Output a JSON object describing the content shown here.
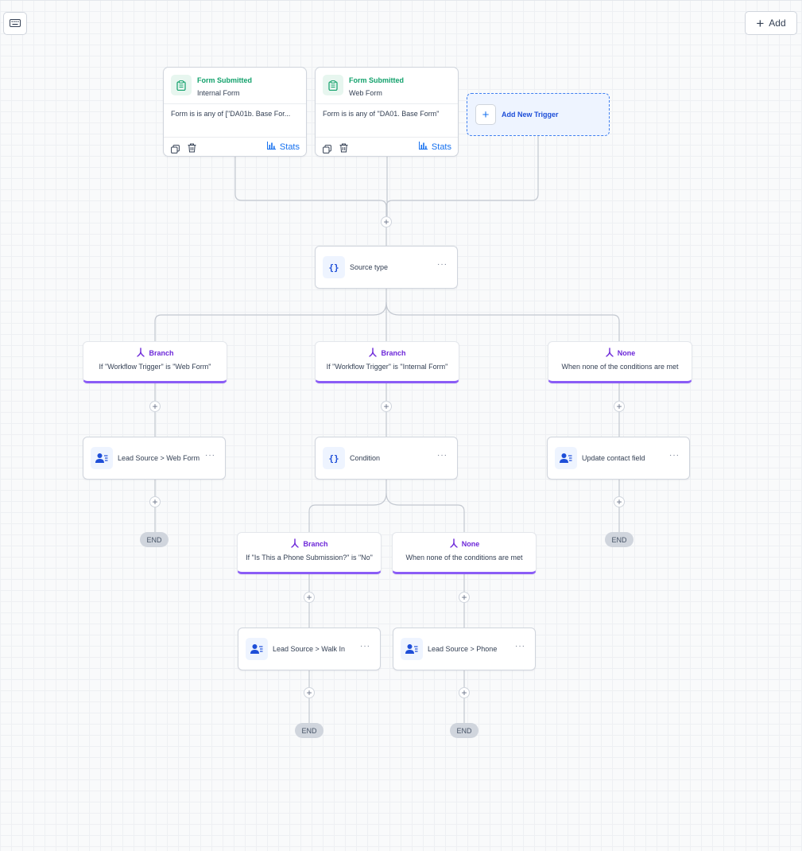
{
  "toolbar": {
    "keyboard_icon": "keyboard-icon",
    "add_label": "Add"
  },
  "triggers": [
    {
      "title": "Form Submitted",
      "subtitle": "Internal Form",
      "filter": "Form is is any of [\"DA01b. Base For...",
      "stats_label": "Stats"
    },
    {
      "title": "Form Submitted",
      "subtitle": "Web Form",
      "filter": "Form is is any of \"DA01. Base Form\"",
      "stats_label": "Stats"
    }
  ],
  "add_trigger_label": "Add New Trigger",
  "source_node": {
    "label": "Source type",
    "icon": "{}"
  },
  "branches_level1": [
    {
      "title": "Branch",
      "desc": "If \"Workflow Trigger\" is \"Web Form\""
    },
    {
      "title": "Branch",
      "desc": "If \"Workflow Trigger\" is \"Internal Form\""
    },
    {
      "title": "None",
      "desc": "When none of the conditions are met"
    }
  ],
  "actions_level1": [
    {
      "label": "Lead Source > Web Form"
    },
    {
      "label": "Condition",
      "icon": "{}"
    },
    {
      "label": "Update contact field"
    }
  ],
  "branches_level2": [
    {
      "title": "Branch",
      "desc": "If \"Is This a Phone Submission?\" is \"No\""
    },
    {
      "title": "None",
      "desc": "When none of the conditions are met"
    }
  ],
  "actions_level2": [
    {
      "label": "Lead Source > Walk In"
    },
    {
      "label": "Lead Source > Phone"
    }
  ],
  "end_label": "END",
  "dots": "···",
  "plus": "+",
  "colors": {
    "trigger_green": "#12a16b",
    "branch_purple": "#6d28d9",
    "branch_border": "#8a5cf6",
    "accent_blue": "#1570ef"
  }
}
